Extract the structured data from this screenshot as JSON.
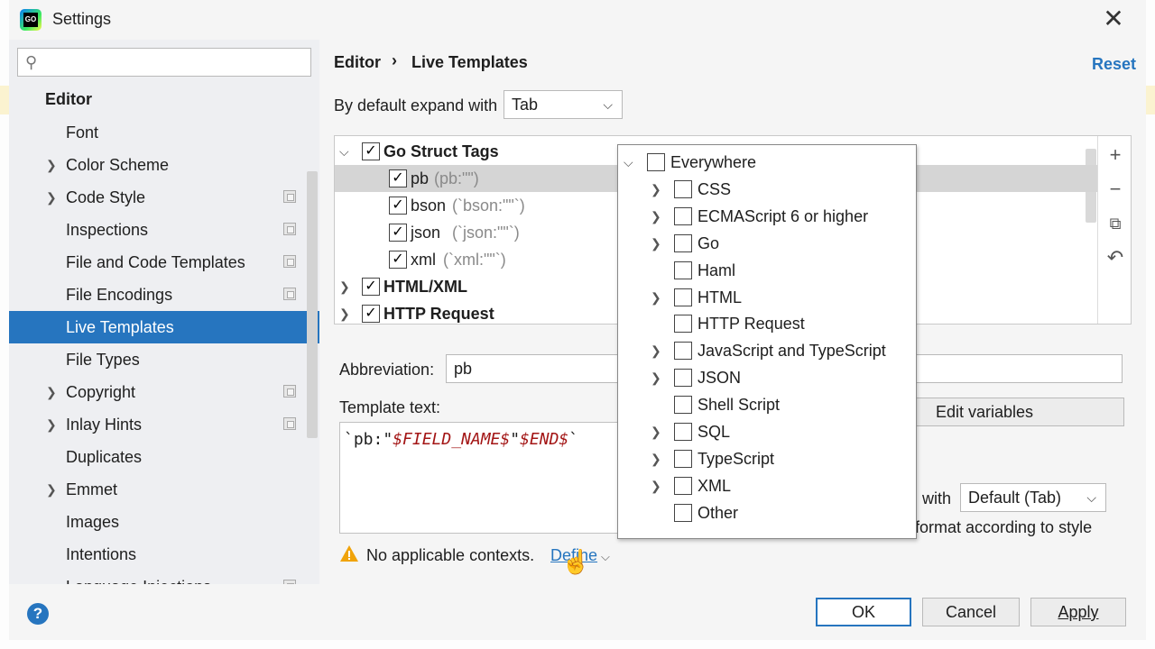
{
  "window": {
    "title": "Settings",
    "app_logo_text": "GO"
  },
  "sidebar": {
    "search_placeholder": "",
    "section_title": "Editor",
    "items": [
      {
        "label": "Font",
        "expandable": false,
        "project_icon": false
      },
      {
        "label": "Color Scheme",
        "expandable": true,
        "project_icon": false
      },
      {
        "label": "Code Style",
        "expandable": true,
        "project_icon": true
      },
      {
        "label": "Inspections",
        "expandable": false,
        "project_icon": true
      },
      {
        "label": "File and Code Templates",
        "expandable": false,
        "project_icon": true
      },
      {
        "label": "File Encodings",
        "expandable": false,
        "project_icon": true
      },
      {
        "label": "Live Templates",
        "expandable": false,
        "project_icon": false,
        "selected": true
      },
      {
        "label": "File Types",
        "expandable": false,
        "project_icon": false
      },
      {
        "label": "Copyright",
        "expandable": true,
        "project_icon": true
      },
      {
        "label": "Inlay Hints",
        "expandable": true,
        "project_icon": true
      },
      {
        "label": "Duplicates",
        "expandable": false,
        "project_icon": false
      },
      {
        "label": "Emmet",
        "expandable": true,
        "project_icon": false
      },
      {
        "label": "Images",
        "expandable": false,
        "project_icon": false
      },
      {
        "label": "Intentions",
        "expandable": false,
        "project_icon": false
      },
      {
        "label": "Language Injections",
        "expandable": false,
        "project_icon": true
      }
    ]
  },
  "breadcrumb": {
    "parent": "Editor",
    "separator": "›",
    "current": "Live Templates"
  },
  "reset_label": "Reset",
  "expand_with": {
    "label": "By default expand with",
    "value": "Tab"
  },
  "templates": [
    {
      "name": "Go Struct Tags",
      "checked": true,
      "group": true,
      "expanded": true
    },
    {
      "name": "pb",
      "desc": "(pb:\"\")",
      "checked": true,
      "group": false,
      "selected": true
    },
    {
      "name": "bson",
      "desc": "(`bson:\"\"`)",
      "checked": true,
      "group": false
    },
    {
      "name": "json",
      "desc": "(`json:\"\"`)",
      "checked": true,
      "group": false
    },
    {
      "name": "xml",
      "desc": "(`xml:\"\"`)",
      "checked": true,
      "group": false
    },
    {
      "name": "HTML/XML",
      "checked": true,
      "group": true,
      "expanded": false
    },
    {
      "name": "HTTP Request",
      "checked": true,
      "group": true,
      "expanded": false
    }
  ],
  "tools": {
    "add": "+",
    "remove": "−",
    "copy": "⧉",
    "revert": "↶"
  },
  "abbreviation": {
    "label": "Abbreviation:",
    "value": "pb"
  },
  "template_text": {
    "label": "Template text:",
    "prefix": "`pb:\"",
    "var1": "$FIELD_NAME$",
    "mid": "\"",
    "var2": "$END$",
    "suffix": "`"
  },
  "edit_variables_label": "Edit variables",
  "options": {
    "with_label": "with",
    "with_value": "Default (Tab)",
    "reformat_label": "format according to style"
  },
  "warning": {
    "text": "No applicable contexts.",
    "define_label": "Define"
  },
  "contexts": [
    {
      "label": "Everywhere",
      "expandable": true,
      "expanded": true,
      "level": 0,
      "checked": false
    },
    {
      "label": "CSS",
      "expandable": true,
      "level": 1,
      "checked": false
    },
    {
      "label": "ECMAScript 6 or higher",
      "expandable": true,
      "level": 1,
      "checked": false
    },
    {
      "label": "Go",
      "expandable": true,
      "level": 1,
      "checked": false
    },
    {
      "label": "Haml",
      "expandable": false,
      "level": 1,
      "checked": false
    },
    {
      "label": "HTML",
      "expandable": true,
      "level": 1,
      "checked": false
    },
    {
      "label": "HTTP Request",
      "expandable": false,
      "level": 1,
      "checked": false
    },
    {
      "label": "JavaScript and TypeScript",
      "expandable": true,
      "level": 1,
      "checked": false
    },
    {
      "label": "JSON",
      "expandable": true,
      "level": 1,
      "checked": false
    },
    {
      "label": "Shell Script",
      "expandable": false,
      "level": 1,
      "checked": false
    },
    {
      "label": "SQL",
      "expandable": true,
      "level": 1,
      "checked": false
    },
    {
      "label": "TypeScript",
      "expandable": true,
      "level": 1,
      "checked": false
    },
    {
      "label": "XML",
      "expandable": true,
      "level": 1,
      "checked": false
    },
    {
      "label": "Other",
      "expandable": false,
      "level": 1,
      "checked": false
    }
  ],
  "footer": {
    "help": "?",
    "ok": "OK",
    "cancel": "Cancel",
    "apply": "Apply"
  },
  "colors": {
    "accent": "#2675bf",
    "selection": "#2675bf",
    "variable": "#a31515"
  },
  "icons": {
    "search": "search-icon",
    "close": "close-icon",
    "warning": "warning-icon",
    "help": "help-icon"
  }
}
